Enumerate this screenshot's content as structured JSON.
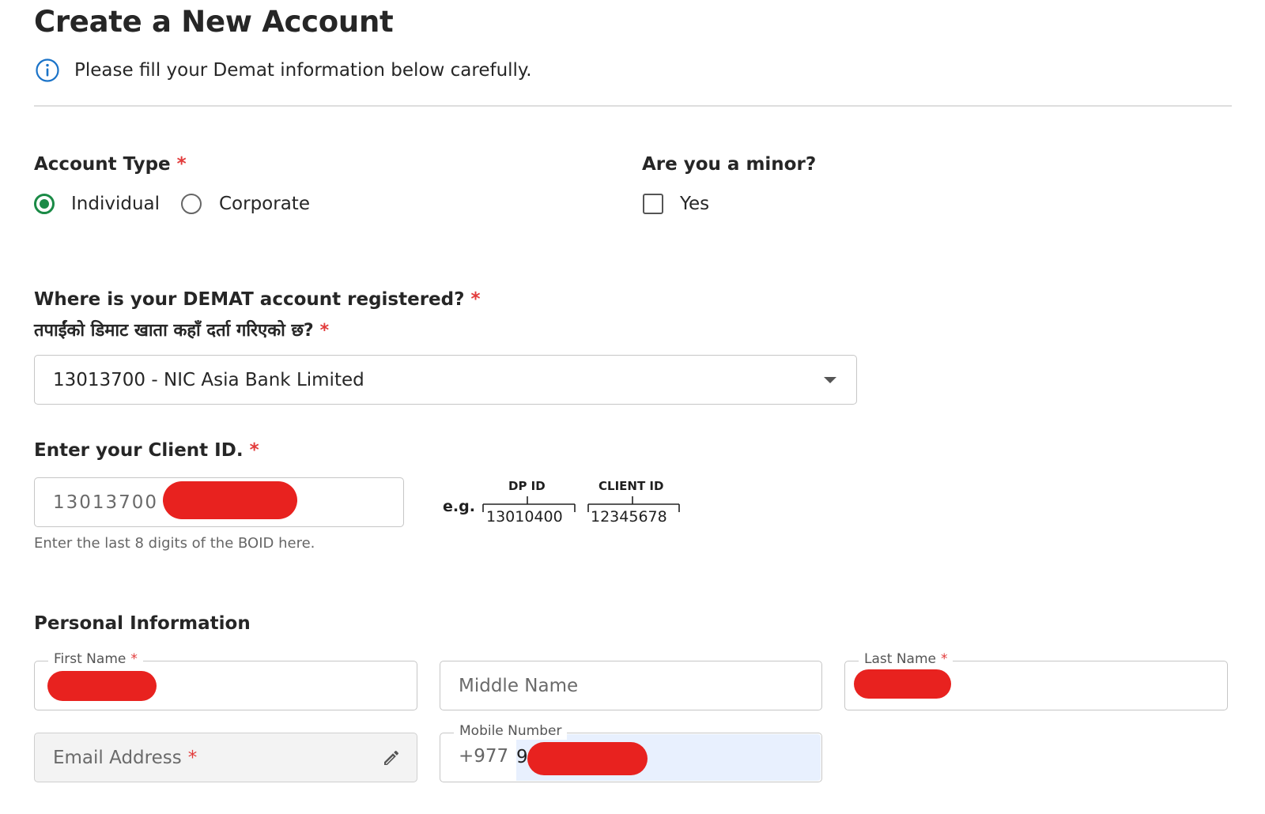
{
  "header": {
    "title": "Create a New Account",
    "info_text": "Please fill your Demat information below carefully."
  },
  "account_type": {
    "label": "Account Type",
    "required_mark": "*",
    "options": [
      {
        "label": "Individual",
        "selected": true
      },
      {
        "label": "Corporate",
        "selected": false
      }
    ]
  },
  "minor": {
    "label": "Are you a minor?",
    "checkbox_label": "Yes",
    "checked": false
  },
  "demat": {
    "label_en": "Where is your DEMAT account registered?",
    "label_np": "तपाईंको डिमाट खाता कहाँ दर्ता गरिएको छ?",
    "required_mark": "*",
    "selected_value": "13013700 - NIC Asia Bank Limited"
  },
  "client_id": {
    "label": "Enter your Client ID.",
    "required_mark": "*",
    "prefix_value": "13013700",
    "hint": "Enter the last 8 digits of the BOID here.",
    "example": {
      "eg": "e.g.",
      "dp_label": "DP ID",
      "client_label": "CLIENT ID",
      "dp_value": "13010400",
      "client_value": "12345678"
    }
  },
  "personal": {
    "heading": "Personal Information",
    "first_name_label": "First Name",
    "middle_name_placeholder": "Middle Name",
    "last_name_label": "Last Name",
    "email_placeholder": "Email Address",
    "mobile_label": "Mobile Number",
    "mobile_prefix": "+977",
    "mobile_visible_digit": "9",
    "required_mark": "*"
  },
  "colors": {
    "accent_green": "#1a8a46",
    "required_red": "#e23b3b",
    "info_blue": "#1a73c8",
    "redaction_red": "#e8221f",
    "autofill_blue": "#e8f0fe"
  }
}
